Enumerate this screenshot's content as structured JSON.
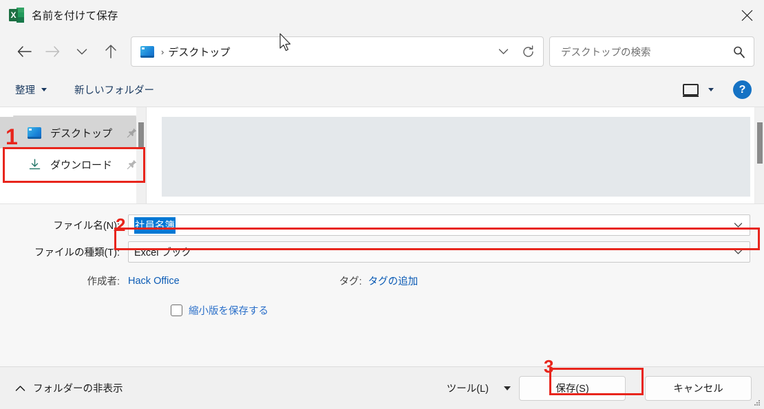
{
  "window": {
    "title": "名前を付けて保存",
    "app_icon": "excel-icon",
    "icon_letter": "X",
    "close_label": "×"
  },
  "nav": {
    "back_icon": "arrow-left-icon",
    "forward_icon": "arrow-right-icon",
    "recent_icon": "chevron-down-icon",
    "up_icon": "arrow-up-icon",
    "address": {
      "folder_icon": "desktop-icon",
      "separator": "›",
      "path_label": "デスクトップ",
      "dropdown_icon": "chevron-down-icon",
      "refresh_icon": "refresh-icon"
    },
    "search": {
      "placeholder": "デスクトップの検索",
      "icon": "search-icon"
    }
  },
  "toolbar": {
    "organize_label": "整理",
    "organize_icon": "caret-down-icon",
    "new_folder_label": "新しいフォルダー",
    "view_icon": "layout-view-icon",
    "view_caret_icon": "caret-down-icon",
    "help_label": "?",
    "help_icon": "help-icon"
  },
  "sidebar": {
    "items": [
      {
        "label": "デスクトップ",
        "icon": "desktop-icon",
        "pin_icon": "pin-icon",
        "selected": true
      },
      {
        "label": "ダウンロード",
        "icon": "download-icon",
        "pin_icon": "pin-icon",
        "selected": false
      }
    ]
  },
  "form": {
    "filename_label": "ファイル名(N):",
    "filename_value": "社員名簿",
    "filename_caret_icon": "chevron-down-icon",
    "filetype_label": "ファイルの種類(T):",
    "filetype_value": "Excel ブック",
    "filetype_caret_icon": "chevron-down-icon",
    "author_label": "作成者:",
    "author_value": "Hack Office",
    "tags_label": "タグ:",
    "tags_value": "タグの追加",
    "thumbnail_label": "縮小版を保存する",
    "thumbnail_checked": false
  },
  "footer": {
    "hide_folders_label": "フォルダーの非表示",
    "hide_folders_icon": "chevron-up-icon",
    "tools_label": "ツール(L)",
    "tools_caret_icon": "caret-down-icon",
    "save_label": "保存(S)",
    "cancel_label": "キャンセル"
  },
  "annotations": {
    "color": "#e8251c",
    "markers": [
      {
        "number": "1",
        "target": "sidebar-item-desktop"
      },
      {
        "number": "2",
        "target": "filename-combo"
      },
      {
        "number": "3",
        "target": "save-button"
      }
    ]
  }
}
